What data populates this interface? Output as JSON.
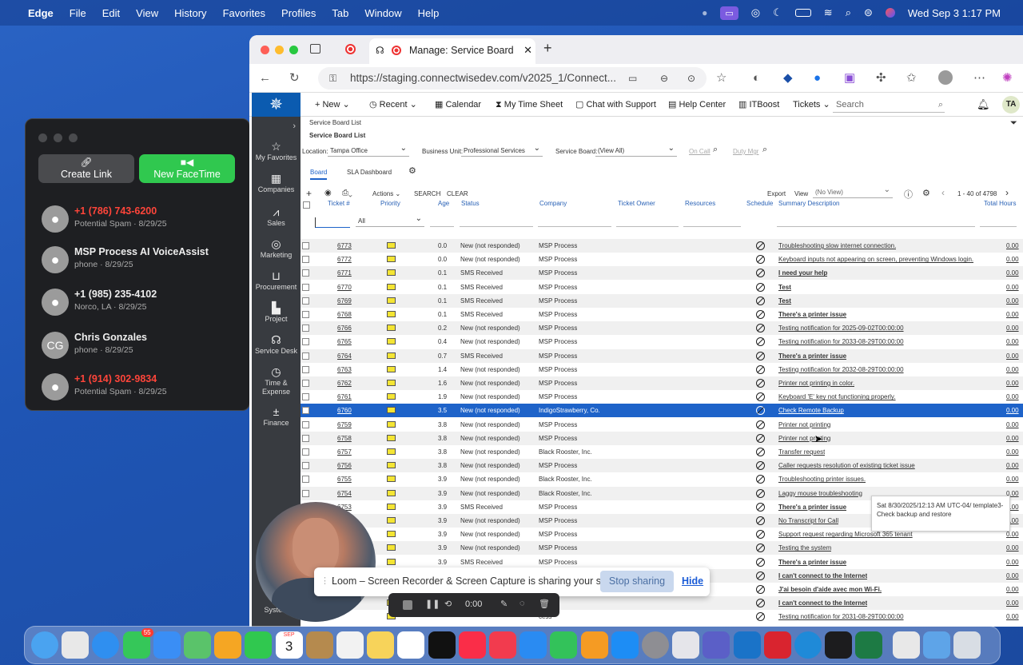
{
  "menubar": {
    "app": "Edge",
    "items": [
      "File",
      "Edit",
      "View",
      "History",
      "Favorites",
      "Profiles",
      "Tab",
      "Window",
      "Help"
    ],
    "clock": "Wed Sep 3  1:17 PM"
  },
  "facetime": {
    "create_link": "Create Link",
    "new_facetime": "New FaceTime",
    "contacts": [
      {
        "name": "+1 (786) 743-6200",
        "sub": "Potential Spam · 8/29/25",
        "red": true,
        "avatar": ""
      },
      {
        "name": "MSP Process AI VoiceAssist",
        "sub": "phone · 8/29/25",
        "red": false,
        "avatar": ""
      },
      {
        "name": "+1 (985) 235-4102",
        "sub": "Norco, LA · 8/29/25",
        "red": false,
        "avatar": ""
      },
      {
        "name": "Chris Gonzales",
        "sub": "phone · 8/29/25",
        "red": false,
        "avatar": "CG"
      },
      {
        "name": "+1 (914) 302-9834",
        "sub": "Potential Spam · 8/29/25",
        "red": true,
        "avatar": ""
      }
    ]
  },
  "browser": {
    "tab_title": "Manage: Service Board",
    "url": "https://staging.connectwisedev.com/v2025_1/Connect..."
  },
  "cw": {
    "nav": {
      "new": "New",
      "recent": "Recent",
      "calendar": "Calendar",
      "timesheet": "My Time Sheet",
      "chat": "Chat with Support",
      "help": "Help Center",
      "itboost": "ITBoost",
      "tickets": "Tickets",
      "search_placeholder": "Search",
      "user": "TA"
    },
    "sidebar": [
      "My Favorites",
      "Companies",
      "Sales",
      "Marketing",
      "Procurement",
      "Project",
      "Service Desk",
      "Time & Expense",
      "Finance",
      "System"
    ],
    "breadcrumb": "Service Board List",
    "page_title": "Service Board List",
    "filters": {
      "location_label": "Location:",
      "location": "Tampa Office",
      "bu_label": "Business Unit:",
      "bu": "Professional Services",
      "board_label": "Service Board:",
      "board": "(View All)",
      "on_call": "On Call",
      "duty_mgr": "Duty Mgr"
    },
    "tabs": [
      "Board",
      "SLA Dashboard"
    ],
    "toolbar": {
      "actions": "Actions",
      "search": "SEARCH",
      "clear": "CLEAR",
      "export": "Export",
      "view_label": "View",
      "view": "(No View)",
      "paging": "1 - 40 of 4798"
    },
    "columns": [
      "Ticket #",
      "Priority",
      "Age",
      "Status",
      "Company",
      "Ticket Owner",
      "Resources",
      "Schedule",
      "Summary Description",
      "Total Hours"
    ],
    "filter_all": "All",
    "tickets": [
      {
        "num": "6773",
        "age": "0.0",
        "status": "New (not responded)",
        "company": "MSP Process",
        "summary": "Troubleshooting slow internet connection.",
        "bold": false,
        "hours": "0.00"
      },
      {
        "num": "6772",
        "age": "0.0",
        "status": "New (not responded)",
        "company": "MSP Process",
        "summary": "Keyboard inputs not appearing on screen, preventing Windows login.",
        "bold": false,
        "hours": "0.00"
      },
      {
        "num": "6771",
        "age": "0.1",
        "status": "SMS Received",
        "company": "MSP Process",
        "summary": "I need your help",
        "bold": true,
        "hours": "0.00"
      },
      {
        "num": "6770",
        "age": "0.1",
        "status": "SMS Received",
        "company": "MSP Process",
        "summary": "Test",
        "bold": true,
        "hours": "0.00"
      },
      {
        "num": "6769",
        "age": "0.1",
        "status": "SMS Received",
        "company": "MSP Process",
        "summary": "Test",
        "bold": true,
        "hours": "0.00"
      },
      {
        "num": "6768",
        "age": "0.1",
        "status": "SMS Received",
        "company": "MSP Process",
        "summary": "There's a printer issue",
        "bold": true,
        "hours": "0.00"
      },
      {
        "num": "6766",
        "age": "0.2",
        "status": "New (not responded)",
        "company": "MSP Process",
        "summary": "Testing notification for 2025-09-02T00:00:00",
        "bold": false,
        "hours": "0.00"
      },
      {
        "num": "6765",
        "age": "0.4",
        "status": "New (not responded)",
        "company": "MSP Process",
        "summary": "Testing notification for 2033-08-29T00:00:00",
        "bold": false,
        "hours": "0.00"
      },
      {
        "num": "6764",
        "age": "0.7",
        "status": "SMS Received",
        "company": "MSP Process",
        "summary": "There's a printer issue",
        "bold": true,
        "hours": "0.00"
      },
      {
        "num": "6763",
        "age": "1.4",
        "status": "New (not responded)",
        "company": "MSP Process",
        "summary": "Testing notification for 2032-08-29T00:00:00",
        "bold": false,
        "hours": "0.00"
      },
      {
        "num": "6762",
        "age": "1.6",
        "status": "New (not responded)",
        "company": "MSP Process",
        "summary": "Printer not printing in color.",
        "bold": false,
        "hours": "0.00"
      },
      {
        "num": "6761",
        "age": "1.9",
        "status": "New (not responded)",
        "company": "MSP Process",
        "summary": "Keyboard 'E' key not functioning properly.",
        "bold": false,
        "hours": "0.00"
      },
      {
        "num": "6760",
        "age": "3.5",
        "status": "New (not responded)",
        "company": "IndigoStrawberry, Co.",
        "summary": "Check Remote Backup",
        "bold": false,
        "hours": "0.00",
        "selected": true
      },
      {
        "num": "6759",
        "age": "3.8",
        "status": "New (not responded)",
        "company": "MSP Process",
        "summary": "Printer not printing",
        "bold": false,
        "hours": "0.00"
      },
      {
        "num": "6758",
        "age": "3.8",
        "status": "New (not responded)",
        "company": "MSP Process",
        "summary": "Printer not printing",
        "bold": false,
        "hours": "0.00"
      },
      {
        "num": "6757",
        "age": "3.8",
        "status": "New (not responded)",
        "company": "Black Rooster, Inc.",
        "summary": "Transfer request",
        "bold": false,
        "hours": "0.00"
      },
      {
        "num": "6756",
        "age": "3.8",
        "status": "New (not responded)",
        "company": "MSP Process",
        "summary": "Caller requests resolution of existing ticket issue",
        "bold": false,
        "hours": "0.00"
      },
      {
        "num": "6755",
        "age": "3.9",
        "status": "New (not responded)",
        "company": "Black Rooster, Inc.",
        "summary": "Troubleshooting printer issues.",
        "bold": false,
        "hours": "0.00"
      },
      {
        "num": "6754",
        "age": "3.9",
        "status": "New (not responded)",
        "company": "Black Rooster, Inc.",
        "summary": "Laggy mouse troubleshooting",
        "bold": false,
        "hours": "0.00"
      },
      {
        "num": "6753",
        "age": "3.9",
        "status": "SMS Received",
        "company": "MSP Process",
        "summary": "There's a printer issue",
        "bold": true,
        "hours": "0.00"
      },
      {
        "num": "",
        "age": "3.9",
        "status": "New (not responded)",
        "company": "MSP Process",
        "summary": "No Transcript for Call",
        "bold": false,
        "hours": "0.00"
      },
      {
        "num": "",
        "age": "3.9",
        "status": "New (not responded)",
        "company": "MSP Process",
        "summary": "Support request regarding Microsoft 365 tenant",
        "bold": false,
        "hours": "0.00"
      },
      {
        "num": "",
        "age": "3.9",
        "status": "New (not responded)",
        "company": "MSP Process",
        "summary": "Testing the system",
        "bold": false,
        "hours": "0.00"
      },
      {
        "num": "",
        "age": "3.9",
        "status": "SMS Received",
        "company": "MSP Process",
        "summary": "There's a printer issue",
        "bold": true,
        "hours": "0.00"
      },
      {
        "num": "",
        "age": "",
        "status": "",
        "company": "",
        "summary": "I can't connect to the Internet",
        "bold": true,
        "hours": "0.00"
      },
      {
        "num": "",
        "age": "",
        "status": "",
        "company": "",
        "summary": "J'ai besoin d'aide avec mon Wi-Fi.",
        "bold": true,
        "hours": "0.00"
      },
      {
        "num": "",
        "age": "",
        "status": "",
        "company": "cess",
        "summary": "I can't connect to the Internet",
        "bold": true,
        "hours": "0.00"
      },
      {
        "num": "",
        "age": "",
        "status": "",
        "company": "cess",
        "summary": "Testing notification for 2031-08-29T00:00:00",
        "bold": false,
        "hours": "0.00"
      }
    ],
    "tooltip": "Sat 8/30/2025/12:13 AM UTC-04/ template3-\nCheck backup and restore"
  },
  "loom": {
    "message": "Loom – Screen Recorder & Screen Capture is sharing your screen.",
    "stop": "Stop sharing",
    "hide": "Hide",
    "timer": "0:00"
  },
  "dock": {
    "calendar_month": "SEP",
    "calendar_day": "3",
    "messages_badge": "55"
  },
  "colors": {
    "cw_blue": "#0b5bb0",
    "selected_row": "#1e63c9",
    "priority_yellow": "#f4e534",
    "facetime_green": "#30c84f",
    "spam_red": "#ff453a"
  }
}
